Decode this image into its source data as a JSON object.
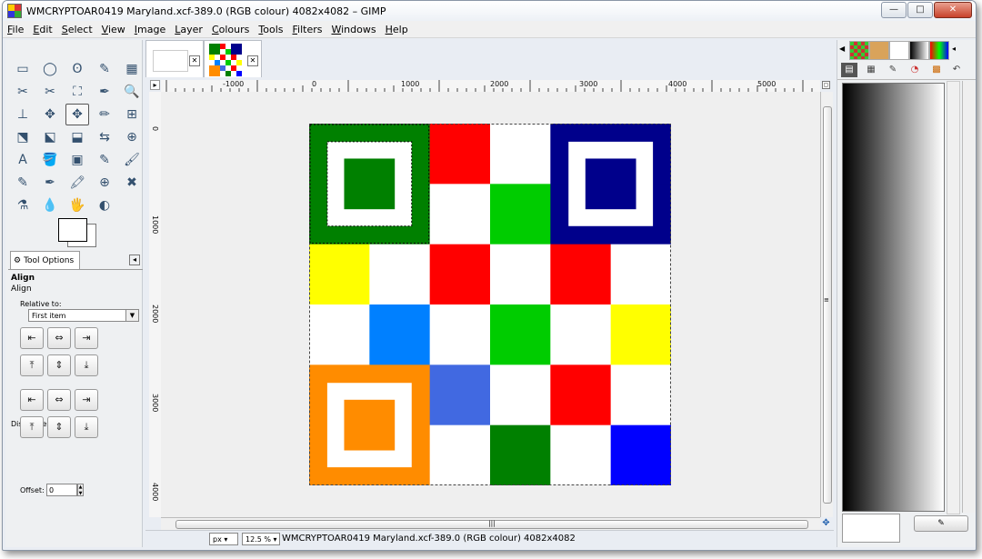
{
  "window": {
    "title": "WMCRYPTOAR0419 Maryland.xcf-389.0 (RGB colour) 4082x4082 – GIMP",
    "controls": {
      "minimize": "—",
      "maximize": "□",
      "close": "✕"
    }
  },
  "menubar": [
    "File",
    "Edit",
    "Select",
    "View",
    "Image",
    "Layer",
    "Colours",
    "Tools",
    "Filters",
    "Windows",
    "Help"
  ],
  "toolbox": {
    "tool_glyphs": [
      "▭",
      "◯",
      "ʘ",
      "✎",
      "▦",
      "✂",
      "✂",
      "⛶",
      "✒",
      "🔍",
      "⊥",
      "✥",
      "✥",
      "✏",
      "⊞",
      "⬔",
      "⬕",
      "⬓",
      "⇆",
      "⊕",
      "A",
      "🪣",
      "▣",
      "✎",
      "🖌",
      "✎",
      "✒",
      "🖍",
      "⊕",
      "✖",
      "⚗",
      "💧",
      "🖐",
      "◐"
    ],
    "tool_names": [
      "rect-select-icon",
      "ellipse-select-icon",
      "free-select-icon",
      "fuzzy-select-icon",
      "color-select-icon",
      "scissors-icon",
      "foreground-select-icon",
      "paths-icon",
      "color-picker-icon",
      "zoom-icon",
      "measure-icon",
      "move-icon",
      "align-icon",
      "crop-icon",
      "rotate-icon",
      "scale-icon",
      "shear-icon",
      "perspective-icon",
      "flip-icon",
      "cage-icon",
      "text-icon",
      "bucket-fill-icon",
      "blend-icon",
      "pencil-icon",
      "paintbrush-icon",
      "eraser-icon",
      "airbrush-icon",
      "ink-icon",
      "clone-icon",
      "heal-icon",
      "perspective-clone-icon",
      "smudge-icon",
      "dodge-burn-icon",
      "blur-icon"
    ]
  },
  "tool_options": {
    "tab_label": "Tool Options",
    "title": "Align",
    "subtitle": "Align",
    "relative_label": "Relative to:",
    "relative_value": "First item",
    "distribute_label": "Distribute",
    "offset_label": "Offset:",
    "offset_value": "0",
    "align_glyphs": [
      "⇤",
      "⇔",
      "⇥",
      "⤒",
      "⇕",
      "⤓"
    ],
    "distribute_glyphs": [
      "⇤",
      "⇔",
      "⇥",
      "⤒",
      "⇕",
      "⤓"
    ]
  },
  "rulers": {
    "h_ticks": [
      "-1000",
      "0",
      "1000",
      "2000",
      "3000",
      "4000",
      "5000"
    ],
    "v_ticks": [
      "0",
      "1000",
      "2000",
      "3000",
      "4000"
    ]
  },
  "image": {
    "colors": {
      "green": "#008000",
      "navy": "#00008b",
      "red": "#ff0000",
      "lime": "#00cc00",
      "yellow": "#ffff00",
      "azure": "#0080ff",
      "orange": "#ff8c00",
      "royal": "#4169e1",
      "blue": "#0000ff",
      "white": "#ffffff"
    },
    "grid": [
      [
        "green",
        "green",
        "red",
        "white",
        "navy",
        "navy"
      ],
      [
        "green",
        "green",
        "white",
        "lime",
        "navy",
        "navy"
      ],
      [
        "yellow",
        "white",
        "red",
        "white",
        "red",
        "white"
      ],
      [
        "white",
        "azure",
        "white",
        "lime",
        "white",
        "yellow"
      ],
      [
        "orange",
        "orange",
        "royal",
        "white",
        "red",
        "white"
      ],
      [
        "orange",
        "orange",
        "white",
        "green",
        "white",
        "blue"
      ]
    ]
  },
  "status": {
    "unit": "px",
    "zoom": "12.5 %",
    "text": "WMCRYPTOAR0419 Maryland.xcf-389.0 (RGB colour) 4082x4082"
  }
}
